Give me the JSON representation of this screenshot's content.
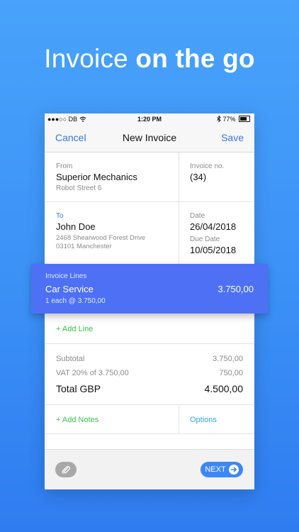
{
  "headline": {
    "light": "Invoice",
    "bold": "on the go"
  },
  "status_bar": {
    "carrier": "●●●○○ DB",
    "time": "1:20 PM",
    "battery": "77%"
  },
  "nav": {
    "cancel": "Cancel",
    "title": "New Invoice",
    "save": "Save"
  },
  "from": {
    "label": "From",
    "name": "Superior Mechanics",
    "address": "Robot Street 6"
  },
  "invoice_no": {
    "label": "Invoice no.",
    "value": "(34)"
  },
  "to": {
    "label": "To",
    "name": "John Doe",
    "address1": "2468 Shearwood Forest Drive",
    "address2": "03101 Manchester"
  },
  "date": {
    "label": "Date",
    "value": "26/04/2018",
    "due_label": "Due Date",
    "due_value": "10/05/2018"
  },
  "invoice_lines": {
    "label": "Invoice Lines",
    "items": [
      {
        "name": "Car Service",
        "amount": "3.750,00",
        "detail": "1 each @ 3.750,00"
      }
    ]
  },
  "add_line": "+ Add Line",
  "summary": {
    "subtotal_label": "Subtotal",
    "subtotal_value": "3.750,00",
    "vat_label": "VAT 20% of 3.750,00",
    "vat_value": "750,00",
    "total_label": "Total GBP",
    "total_value": "4.500,00"
  },
  "add_notes": "+ Add Notes",
  "options": "Options",
  "bottom_bar": {
    "next": "NEXT"
  },
  "icons": {
    "attach": "paperclip-icon",
    "next_arrow": "arrow-right-icon",
    "wifi": "wifi-icon",
    "bluetooth": "bluetooth-icon",
    "battery": "battery-icon"
  },
  "colors": {
    "background": "#3f95f8",
    "accent": "#4d70f5",
    "link": "#3a76d8",
    "green": "#3bbf4a",
    "options": "#2fa8de"
  }
}
